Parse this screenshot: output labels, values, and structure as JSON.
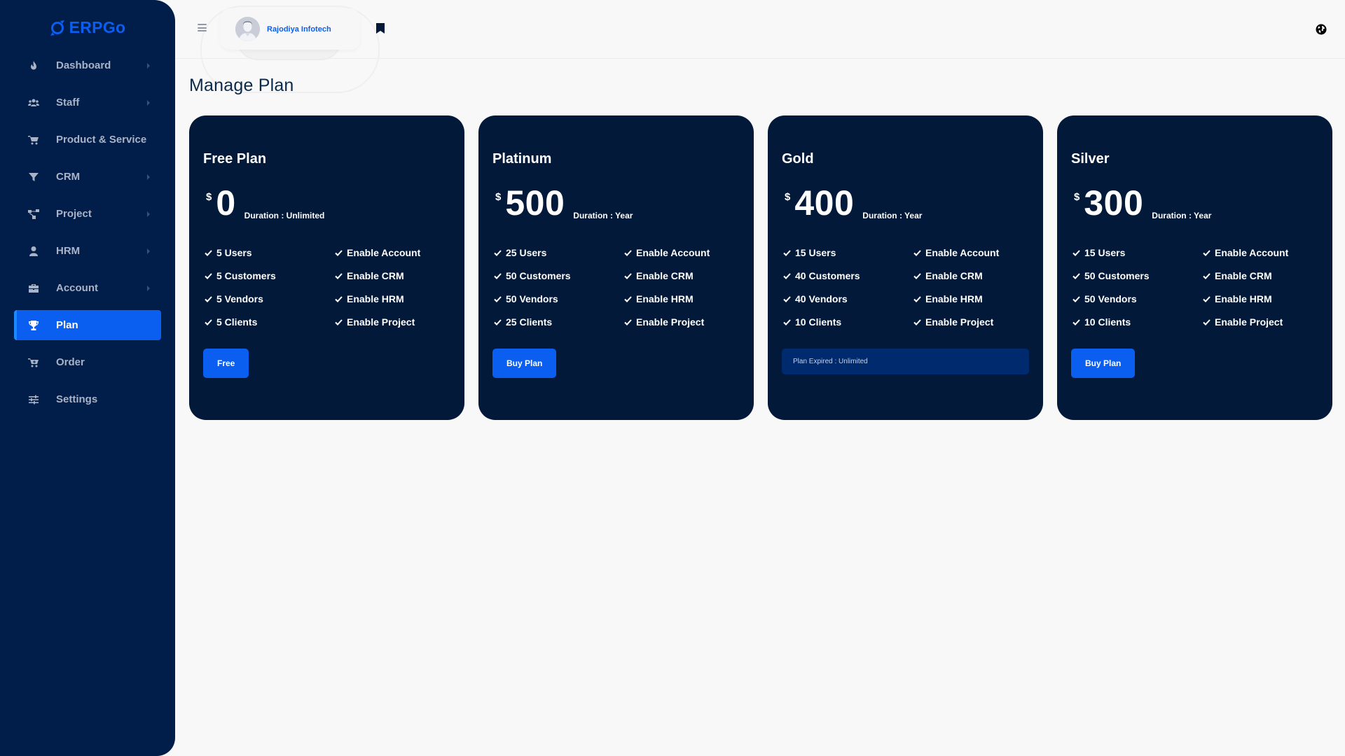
{
  "app": {
    "name": "ERPGo",
    "brand_color": "#0a5ef0",
    "sidebar_color": "#011d4a",
    "card_color": "#021939"
  },
  "sidebar": {
    "items": [
      {
        "label": "Dashboard",
        "icon": "fire-icon",
        "has_submenu": true,
        "active": false
      },
      {
        "label": "Staff",
        "icon": "users-icon",
        "has_submenu": true,
        "active": false
      },
      {
        "label": "Product & Service",
        "icon": "cart-icon",
        "has_submenu": false,
        "active": false
      },
      {
        "label": "CRM",
        "icon": "filter-icon",
        "has_submenu": true,
        "active": false
      },
      {
        "label": "Project",
        "icon": "project-diagram-icon",
        "has_submenu": true,
        "active": false
      },
      {
        "label": "HRM",
        "icon": "user-icon",
        "has_submenu": true,
        "active": false
      },
      {
        "label": "Account",
        "icon": "briefcase-icon",
        "has_submenu": true,
        "active": false
      },
      {
        "label": "Plan",
        "icon": "trophy-icon",
        "has_submenu": false,
        "active": true
      },
      {
        "label": "Order",
        "icon": "cart-plus-icon",
        "has_submenu": false,
        "active": false
      },
      {
        "label": "Settings",
        "icon": "sliders-icon",
        "has_submenu": false,
        "active": false
      }
    ]
  },
  "header": {
    "user_name": "Rajodiya Infotech",
    "icons": [
      "menu-icon",
      "bookmark-icon",
      "globe-icon"
    ]
  },
  "page": {
    "title": "Manage Plan"
  },
  "plans": [
    {
      "name": "Free Plan",
      "currency": "$",
      "price": "0",
      "duration": "Duration : Unlimited",
      "features_left": [
        "5 Users",
        "5 Customers",
        "5 Vendors",
        "5 Clients"
      ],
      "features_right": [
        "Enable Account",
        "Enable CRM",
        "Enable HRM",
        "Enable Project"
      ],
      "action": {
        "type": "button",
        "label": "Free"
      }
    },
    {
      "name": "Platinum",
      "currency": "$",
      "price": "500",
      "duration": "Duration : Year",
      "features_left": [
        "25 Users",
        "50 Customers",
        "50 Vendors",
        "25 Clients"
      ],
      "features_right": [
        "Enable Account",
        "Enable CRM",
        "Enable HRM",
        "Enable Project"
      ],
      "action": {
        "type": "button",
        "label": "Buy Plan"
      }
    },
    {
      "name": "Gold",
      "currency": "$",
      "price": "400",
      "duration": "Duration : Year",
      "features_left": [
        "15 Users",
        "40 Customers",
        "40 Vendors",
        "10 Clients"
      ],
      "features_right": [
        "Enable Account",
        "Enable CRM",
        "Enable HRM",
        "Enable Project"
      ],
      "action": {
        "type": "status",
        "label": "Plan Expired : Unlimited"
      }
    },
    {
      "name": "Silver",
      "currency": "$",
      "price": "300",
      "duration": "Duration : Year",
      "features_left": [
        "15 Users",
        "50 Customers",
        "50 Vendors",
        "10 Clients"
      ],
      "features_right": [
        "Enable Account",
        "Enable CRM",
        "Enable HRM",
        "Enable Project"
      ],
      "action": {
        "type": "button",
        "label": "Buy Plan"
      }
    }
  ]
}
